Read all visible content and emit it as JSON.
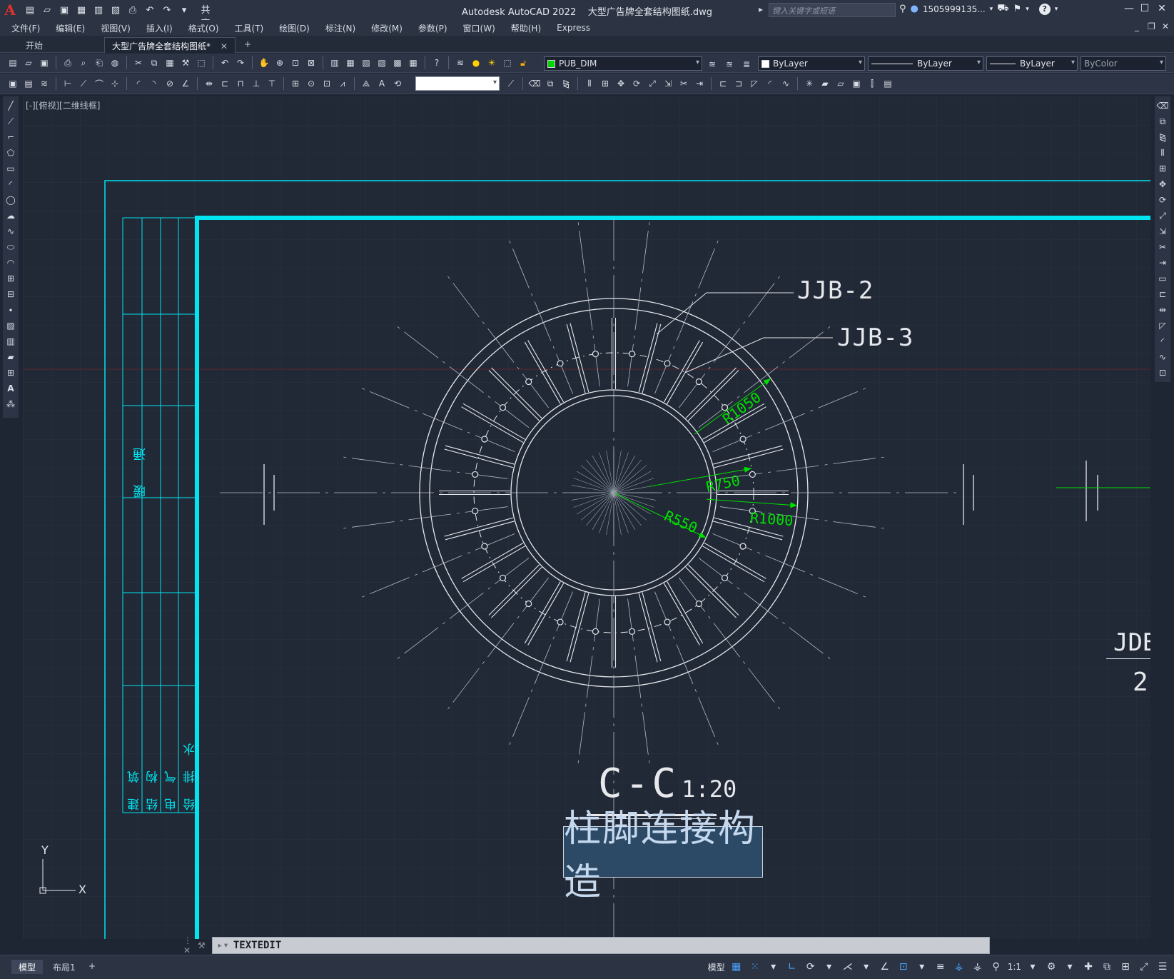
{
  "titlebar": {
    "logo": "A",
    "share_label": "共享",
    "app_title": "Autodesk AutoCAD 2022",
    "doc_title": "大型广告牌全套结构图纸.dwg",
    "search_placeholder": "键入关键字或短语",
    "user": "1505999135...",
    "help": "?"
  },
  "menu": [
    "文件(F)",
    "编辑(E)",
    "视图(V)",
    "插入(I)",
    "格式(O)",
    "工具(T)",
    "绘图(D)",
    "标注(N)",
    "修改(M)",
    "参数(P)",
    "窗口(W)",
    "帮助(H)",
    "Express"
  ],
  "tabs": {
    "start": "开始",
    "active": "大型广告牌全套结构图纸*",
    "close": "✕",
    "add": "+"
  },
  "properties": {
    "layer": "PUB_DIM",
    "layer_color": "#00d400",
    "color": "ByLayer",
    "linetype": "ByLayer",
    "lineweight": "ByLayer",
    "plotstyle": "ByColor"
  },
  "viewport": {
    "label": "[-][俯视][二维线框]"
  },
  "drawing": {
    "leader_1": "JJB-2",
    "leader_2": "JJB-3",
    "dim_r1050": "R1050",
    "dim_r750": "R750",
    "dim_r550": "R550",
    "dim_r1000": "R1000",
    "section_title": "C-C",
    "section_scale": "1:20",
    "caption": "柱脚连接构造",
    "right_label": "JDB",
    "right_num": "2",
    "table_text_1": "暖 通",
    "table_cols": [
      "建 筑",
      "结 构",
      "电 气",
      "给 排 水"
    ],
    "axis_y": "Y",
    "axis_x": "X",
    "line_color": "#e6e8ec",
    "frame_color": "#00e5f0",
    "dim_color": "#00e000"
  },
  "cmdline": {
    "prompt": "TEXTEDIT"
  },
  "statusbar": {
    "model_tab": "模型",
    "layout_tab": "布局1",
    "add": "+",
    "model_label": "模型",
    "scale": "1:1"
  }
}
